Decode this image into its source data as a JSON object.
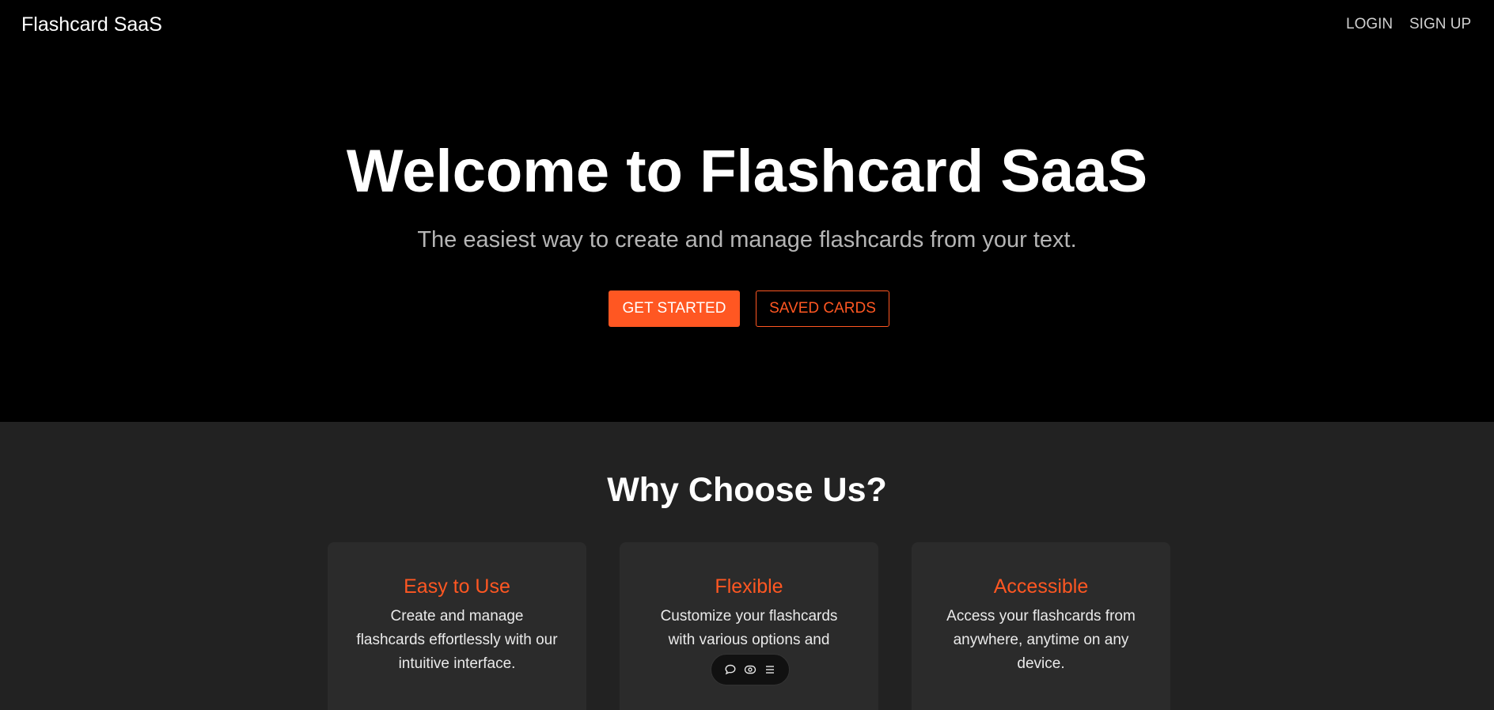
{
  "header": {
    "brand": "Flashcard SaaS",
    "login_label": "LOGIN",
    "signup_label": "SIGN UP"
  },
  "hero": {
    "title": "Welcome to Flashcard SaaS",
    "subtitle": "The easiest way to create and manage flashcards from your text.",
    "primary_button": "GET STARTED",
    "secondary_button": "SAVED CARDS"
  },
  "features": {
    "title": "Why Choose Us?",
    "cards": [
      {
        "title": "Easy to Use",
        "text": "Create and manage flashcards effortlessly with our intuitive interface."
      },
      {
        "title": "Flexible",
        "text": "Customize your flashcards with various options and"
      },
      {
        "title": "Accessible",
        "text": "Access your flashcards from anywhere, anytime on any device."
      }
    ]
  },
  "toolbar": {
    "icons": [
      "comment-icon",
      "eye-icon",
      "menu-icon"
    ]
  },
  "colors": {
    "accent": "#ff5722",
    "background": "#000000",
    "section_background": "#222222",
    "card_background": "#2b2b2b"
  }
}
